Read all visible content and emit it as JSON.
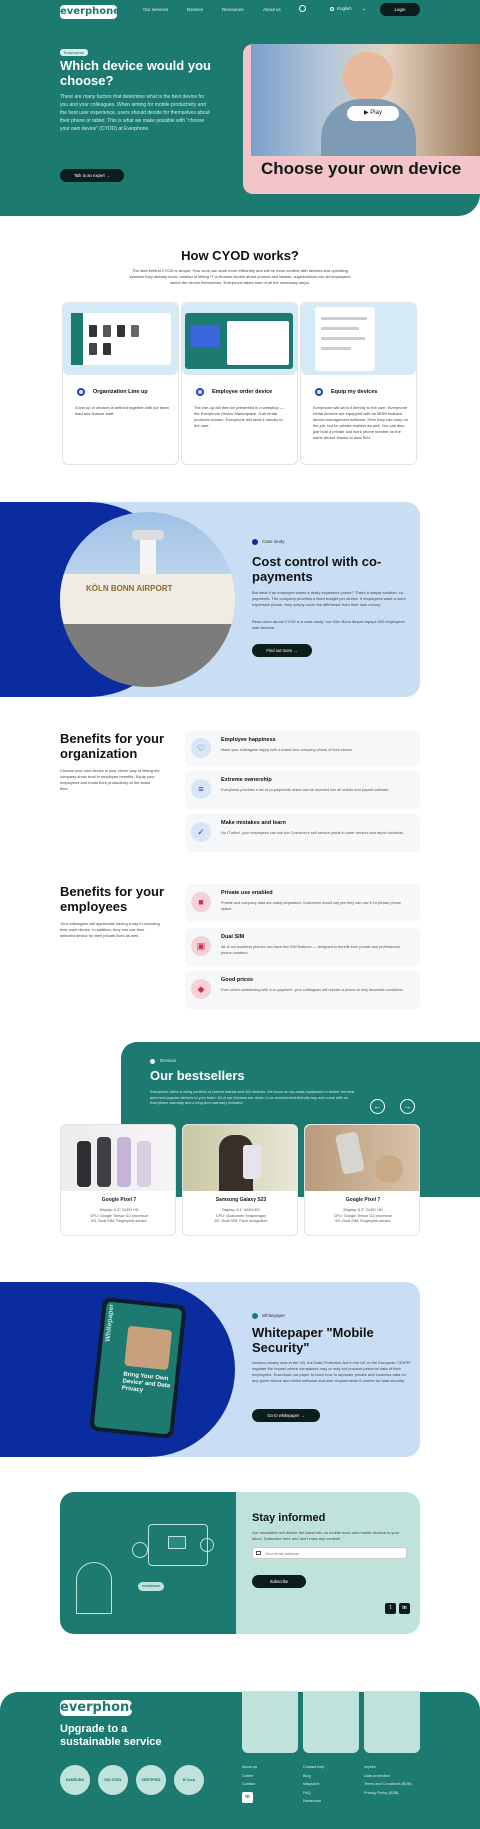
{
  "header": {
    "logo": "everphone",
    "nav": [
      "Our services",
      "Devices",
      "Resources",
      "About us"
    ],
    "language": "English",
    "login": "Login"
  },
  "hero": {
    "tag": "Employees",
    "title": "Which device would you choose?",
    "body": "There are many factors that determine what is the best device for you and your colleagues. When aiming for mobile productivity and the best user experience, users should decide for themselves about their phone or tablet. This is what we make possible with \"choose your own device\" (CYOD) at Everphone.",
    "cta": "Talk to an expert",
    "video_play": "Play",
    "video_title": "Choose your own device"
  },
  "how": {
    "title": "How CYOD works?",
    "intro": "The idea behind CYOD is simple: Your work can work more efficiently and will be more content with devices and operating systems they already know. Instead of letting IT or finance decide about phones and tablets, organizations can let employees select the device themselves. Everphone takes care of all the necessary steps.",
    "steps": [
      {
        "title": "Organization Line up",
        "text": "A line-up of devices is defined together with our team lead and finance staff."
      },
      {
        "title": "Employee order device",
        "text": "The line-up will then be presented in a webshop — the Everphone Device Marketplace. If all rental products chosen, Everphone will send it directly to the user."
      },
      {
        "title": "Equip my devices",
        "text": "Everphone will send it directly to the user. Everphone rental devices are equipped with an MDM enabled device management software. Here they can carry on the job, but for private matters as well. You can also just hold a private and work phone number on the same device thanks to dual SIM."
      }
    ]
  },
  "case": {
    "tag": "Case study",
    "title": "Cost control with co-payments",
    "body1": "But what if an employee wants a really expensive phone? That's a simple solution: co-payments. The company provides a fixed budget per device. If employees want a more expensive phone, they simply cover the difference from their own money.",
    "body2": "Read more about CYOD in a case study: our Köln Bonn Airport equips 500 employees with devices.",
    "cta": "Find out more",
    "image_text": "KÖLN BONN AIRPORT"
  },
  "benefits_org": {
    "title": "Benefits for your organization",
    "body": "Choose your own device is your clever way of letting the company show trust in employee benefits. Equip your employees and boost their productivity at the same time.",
    "items": [
      {
        "title": "Employee happiness",
        "text": "Make your colleagues happy with a brand new company phone of their choice.",
        "icon": "hand-heart-icon"
      },
      {
        "title": "Extreme ownership",
        "text": "Everphone provides a list of co-payments which can be reported into all mobile and payroll software.",
        "icon": "list-icon"
      },
      {
        "title": "Make mistakes and learn",
        "text": "No IT effort, your employees can use the Customer's self-service portal to order devices and report incidents.",
        "icon": "user-check-icon"
      }
    ]
  },
  "benefits_emp": {
    "title": "Benefits for your employees",
    "body": "Your colleagues will appreciate having a say in choosing their work device. In addition, they can use their selected device for their private lives as well.",
    "items": [
      {
        "title": "Private use enabled",
        "text": "Private and company data are safely separated. Customers would say yes they can use it for private phone space.",
        "icon": "briefcase-icon"
      },
      {
        "title": "Dual SIM",
        "text": "All of our business phones can have two SIM features — designed to benefit from private and professional phone numbers.",
        "icon": "sim-icon"
      },
      {
        "title": "Good prices",
        "text": "Even when contributing with a co-payment, your colleagues will receive a phone at very favorable conditions.",
        "icon": "tag-icon"
      }
    ]
  },
  "bestsellers": {
    "tag": "Devices",
    "title": "Our bestsellers",
    "body": "Everphone offers a rising portfolio of current brands and 400 devices. We focus on top-class equipment to deliver the best and most popular devices to your team. All of our Devices are clean, in an environment-friendly way and come with an Everphone warranty and a long-term warranty included.",
    "products": [
      {
        "name": "Google Pixel 7",
        "lines": [
          "Display: 6.3\" OLED HD",
          "CPU: Google Tensor G2 processor",
          "5G, Dual SIM, Fingerprint sensor"
        ]
      },
      {
        "name": "Samsung Galaxy S23",
        "lines": [
          "Display: 6.1\" AMOLED",
          "CPU: Qualcomm Snapdragon",
          "5G, Dual SIM, Face recognition"
        ]
      },
      {
        "name": "Google Pixel 7",
        "lines": [
          "Display: 6.3\" OLED HD",
          "CPU: Google Tensor G2 processor",
          "5G, Dual SIM, Fingerprint sensor"
        ]
      }
    ]
  },
  "whitepaper": {
    "tag": "Whitepaper",
    "title": "Whitepaper \"Mobile Security\"",
    "body": "Various privacy acts in the US, the Data Protection Act in the UK or the European \"GDPR\" regulate the impact where companies may or may not process personal data of their employees. Download our paper to learn how to separate private and business data on any given device and which software and user requirements it carries for data security.",
    "cta": "Go to whitepaper",
    "tablet_lines": [
      "Bring Your Own Device' and Data Privacy"
    ],
    "tablet_side": "Whitepaper"
  },
  "newsletter": {
    "title": "Stay informed",
    "body": "Our newsletter will deliver the latest info on mobile work and mobile devices to your inbox. Subscribe here and don't miss any content!",
    "placeholder": "Your email address",
    "cta": "Subscribe"
  },
  "footer": {
    "logo": "everphone",
    "slogan": "Upgrade to a sustainable service",
    "badges": [
      "SAMSUNG",
      "ISO 27001",
      "CERTIFIED",
      "B Corp"
    ],
    "col1": [
      "About us",
      "Career",
      "Contact"
    ],
    "col2": [
      "Contact help",
      "Blog",
      "Magazine",
      "FAQ",
      "Newsroom"
    ],
    "col3": [
      "Imprint",
      "Data protection",
      "Terms and Conditions (B2B)",
      "Privacy Policy (B2B)"
    ]
  },
  "colors": {
    "teal": "#1c7a70",
    "navy": "#0b2c9e",
    "light_blue": "#c9def4",
    "pink": "#f3c4c8",
    "mint": "#bfe3da"
  }
}
